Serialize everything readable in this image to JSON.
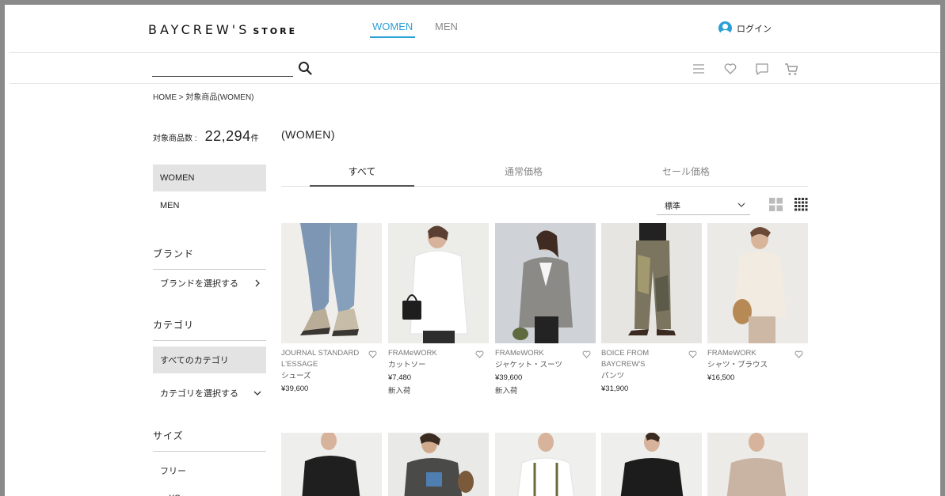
{
  "header": {
    "logo_main": "BAYCREW'S",
    "logo_sub": "STORE",
    "tabs": [
      {
        "label": "WOMEN",
        "active": true
      },
      {
        "label": "MEN",
        "active": false
      }
    ],
    "login_label": "ログイン",
    "accent_color": "#2b9fd6"
  },
  "search": {
    "value": "",
    "placeholder": "",
    "icons": [
      "search-icon",
      "menu-icon",
      "heart-icon",
      "chat-icon",
      "cart-icon"
    ]
  },
  "breadcrumb": "HOME > 対象商品(WOMEN)",
  "sidebar": {
    "count_label": "対象商品数 :",
    "count_value": "22,294",
    "count_unit": "件",
    "gender_items": [
      {
        "label": "WOMEN",
        "selected": true
      },
      {
        "label": "MEN",
        "selected": false
      }
    ],
    "brand_heading": "ブランド",
    "brand_select": "ブランドを選択する",
    "category_heading": "カテゴリ",
    "category_all": "すべてのカテゴリ",
    "category_select": "カテゴリを選択する",
    "size_heading": "サイズ",
    "sizes": [
      "フリー",
      "～XS"
    ]
  },
  "main": {
    "title": "(WOMEN)",
    "price_tabs": [
      {
        "label": "すべて",
        "active": true
      },
      {
        "label": "通常価格",
        "active": false
      },
      {
        "label": "セール価格",
        "active": false
      }
    ],
    "sort_value": "標準",
    "view_icons": [
      "grid-large-icon",
      "grid-small-icon"
    ]
  },
  "products": [
    {
      "brand": "JOURNAL STANDARD L'ESSAGE",
      "category": "シューズ",
      "price": "¥39,600",
      "badge": ""
    },
    {
      "brand": "FRAMeWORK",
      "category": "カットソー",
      "price": "¥7,480",
      "badge": "新入荷"
    },
    {
      "brand": "FRAMeWORK",
      "category": "ジャケット・スーツ",
      "price": "¥39,600",
      "badge": "新入荷"
    },
    {
      "brand": "BOICE FROM BAYCREW'S",
      "category": "パンツ",
      "price": "¥31,900",
      "badge": ""
    },
    {
      "brand": "FRAMeWORK",
      "category": "シャツ・ブラウス",
      "price": "¥16,500",
      "badge": ""
    }
  ]
}
